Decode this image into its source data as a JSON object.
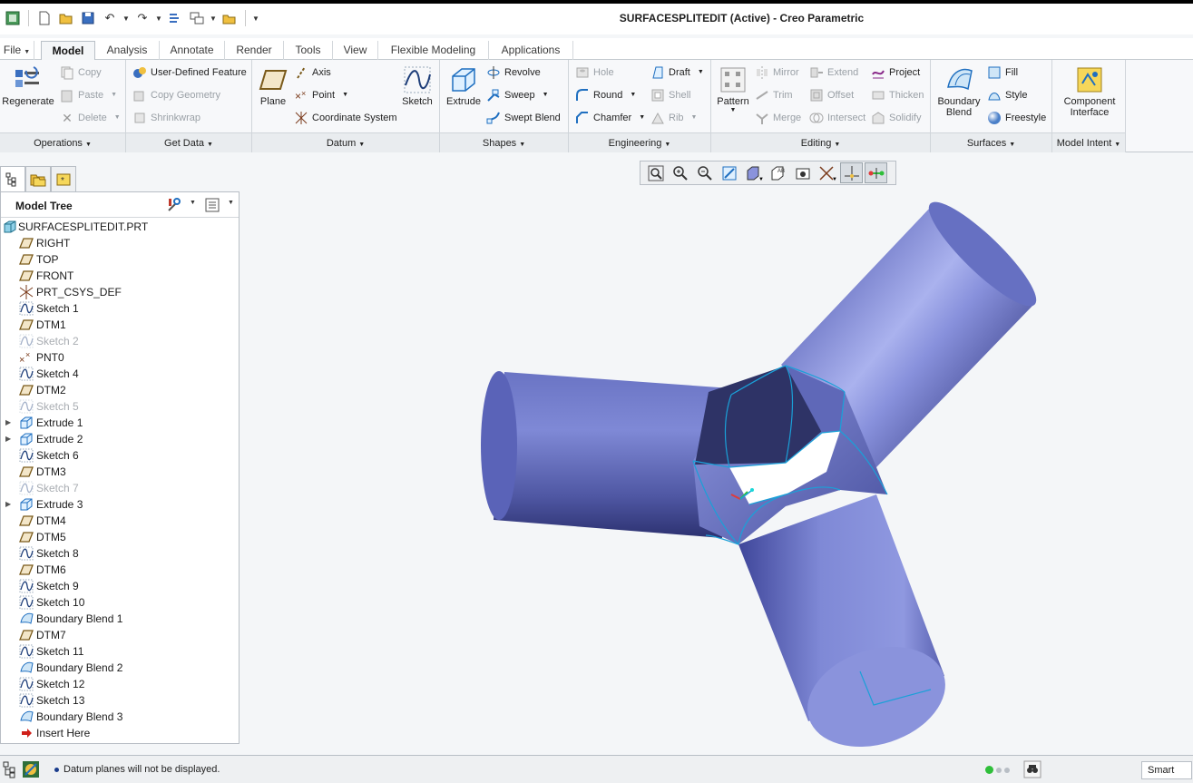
{
  "window": {
    "title": "SURFACESPLITEDIT (Active) - Creo Parametric"
  },
  "tabs": [
    {
      "label": "File",
      "has_dropdown": true
    },
    {
      "label": "Model",
      "active": true
    },
    {
      "label": "Analysis"
    },
    {
      "label": "Annotate"
    },
    {
      "label": "Render"
    },
    {
      "label": "Tools"
    },
    {
      "label": "View"
    },
    {
      "label": "Flexible Modeling"
    },
    {
      "label": "Applications"
    }
  ],
  "ribbon": {
    "operations": {
      "label": "Operations",
      "regenerate": "Regenerate",
      "copy": "Copy",
      "paste": "Paste",
      "delete": "Delete"
    },
    "get_data": {
      "label": "Get Data",
      "udf": "User-Defined Feature",
      "copy_geometry": "Copy Geometry",
      "shrinkwrap": "Shrinkwrap"
    },
    "datum": {
      "label": "Datum",
      "plane": "Plane",
      "axis": "Axis",
      "point": "Point",
      "csys": "Coordinate System",
      "sketch": "Sketch"
    },
    "shapes": {
      "label": "Shapes",
      "extrude": "Extrude",
      "revolve": "Revolve",
      "sweep": "Sweep",
      "swept_blend": "Swept Blend"
    },
    "engineering": {
      "label": "Engineering",
      "hole": "Hole",
      "round": "Round",
      "chamfer": "Chamfer",
      "draft": "Draft",
      "shell": "Shell",
      "rib": "Rib"
    },
    "editing": {
      "label": "Editing",
      "pattern": "Pattern",
      "mirror": "Mirror",
      "trim": "Trim",
      "merge": "Merge",
      "extend": "Extend",
      "offset": "Offset",
      "intersect": "Intersect",
      "project": "Project",
      "thicken": "Thicken",
      "solidify": "Solidify"
    },
    "surfaces": {
      "label": "Surfaces",
      "boundary_blend_1": "Boundary",
      "boundary_blend_2": "Blend",
      "fill": "Fill",
      "style": "Style",
      "freestyle": "Freestyle"
    },
    "model_intent": {
      "label": "Model Intent",
      "component_interface_1": "Component",
      "component_interface_2": "Interface"
    }
  },
  "model_tree": {
    "title": "Model Tree",
    "items": [
      {
        "label": "SURFACESPLITEDIT.PRT",
        "icon": "part-icon",
        "root": true
      },
      {
        "label": "RIGHT",
        "icon": "datum-plane-icon"
      },
      {
        "label": "TOP",
        "icon": "datum-plane-icon"
      },
      {
        "label": "FRONT",
        "icon": "datum-plane-icon"
      },
      {
        "label": "PRT_CSYS_DEF",
        "icon": "csys-icon"
      },
      {
        "label": "Sketch 1",
        "icon": "sketch-icon"
      },
      {
        "label": "DTM1",
        "icon": "datum-plane-icon"
      },
      {
        "label": "Sketch 2",
        "icon": "sketch-icon",
        "dim": true
      },
      {
        "label": "PNT0",
        "icon": "datum-point-icon"
      },
      {
        "label": "Sketch 4",
        "icon": "sketch-icon"
      },
      {
        "label": "DTM2",
        "icon": "datum-plane-icon"
      },
      {
        "label": "Sketch 5",
        "icon": "sketch-icon",
        "dim": true
      },
      {
        "label": "Extrude 1",
        "icon": "extrude-icon",
        "expandable": true
      },
      {
        "label": "Extrude 2",
        "icon": "extrude-icon",
        "expandable": true
      },
      {
        "label": "Sketch 6",
        "icon": "sketch-icon"
      },
      {
        "label": "DTM3",
        "icon": "datum-plane-icon"
      },
      {
        "label": "Sketch 7",
        "icon": "sketch-icon",
        "dim": true
      },
      {
        "label": "Extrude 3",
        "icon": "extrude-icon",
        "expandable": true
      },
      {
        "label": "DTM4",
        "icon": "datum-plane-icon"
      },
      {
        "label": "DTM5",
        "icon": "datum-plane-icon"
      },
      {
        "label": "Sketch 8",
        "icon": "sketch-icon"
      },
      {
        "label": "DTM6",
        "icon": "datum-plane-icon"
      },
      {
        "label": "Sketch 9",
        "icon": "sketch-icon"
      },
      {
        "label": "Sketch 10",
        "icon": "sketch-icon"
      },
      {
        "label": "Boundary Blend 1",
        "icon": "boundary-blend-icon"
      },
      {
        "label": "DTM7",
        "icon": "datum-plane-icon"
      },
      {
        "label": "Sketch 11",
        "icon": "sketch-icon"
      },
      {
        "label": "Boundary Blend 2",
        "icon": "boundary-blend-icon"
      },
      {
        "label": "Sketch 12",
        "icon": "sketch-icon"
      },
      {
        "label": "Sketch 13",
        "icon": "sketch-icon"
      },
      {
        "label": "Boundary Blend 3",
        "icon": "boundary-blend-icon"
      },
      {
        "label": "Insert Here",
        "icon": "insert-here-arrow-icon"
      }
    ]
  },
  "status": {
    "message": "Datum planes will not be displayed.",
    "filter": "Smart"
  },
  "colors": {
    "accent_blue": "#1f6fc0",
    "model_surface": "#7b86cc",
    "edge_cyan": "#1aa0d8",
    "status_green": "#2fbf3a"
  }
}
